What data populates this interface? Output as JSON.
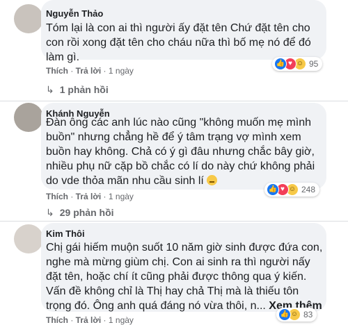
{
  "colors": {
    "bubble": "#f0f2f5",
    "like": "#1877f2",
    "love": "#f33e58",
    "haha": "#f7c948"
  },
  "comments": [
    {
      "author": "Nguyễn Thảo",
      "lines": [
        "Tóm lại là con ai thì người ấy đặt tên Chứ đặt tên cho",
        "con rồi xong đặt tên cho cháu nữa thì bố mẹ nó để đó",
        "làm gì."
      ],
      "like_label": "Thích",
      "reply_label": "Trả lời",
      "time": "1 ngày",
      "reaction_count": "95",
      "replies_label": "1 phản hồi"
    },
    {
      "author": "Khánh Nguyễn",
      "lines": [
        "Đàn ông các anh lúc nào cũng \"không muốn mẹ mình",
        "buồn\" nhưng chẳng hề để ý tâm trạng vợ mình xem",
        "buồn hay không. Chả có ý gì đâu nhưng chắc bây giờ,",
        "nhiều phụ nữ cặp bồ chắc có lí do này chứ không phải",
        "do vde thỏa mãn nhu cầu sinh lí"
      ],
      "like_label": "Thích",
      "reply_label": "Trả lời",
      "time": "1 ngày",
      "reaction_count": "248",
      "replies_label": "29 phản hồi"
    },
    {
      "author": "Kim Thôi",
      "lines": [
        "Chị gái hiếm muộn suốt 10 năm giờ sinh được đứa con,",
        "nghe mà mừng giùm chị. Con ai sinh ra thì người nấy",
        "đặt tên, hoặc chí ít cũng phải được thông qua ý kiến.",
        "Vấn đề không chỉ là Thị hay chả Thị mà là thiếu tôn",
        "trọng đó. Ông anh quá đáng nó vừa thôi, n..."
      ],
      "see_more": "Xem thêm",
      "like_label": "Thích",
      "reply_label": "Trả lời",
      "time": "1 ngày",
      "reaction_count": "83"
    }
  ]
}
